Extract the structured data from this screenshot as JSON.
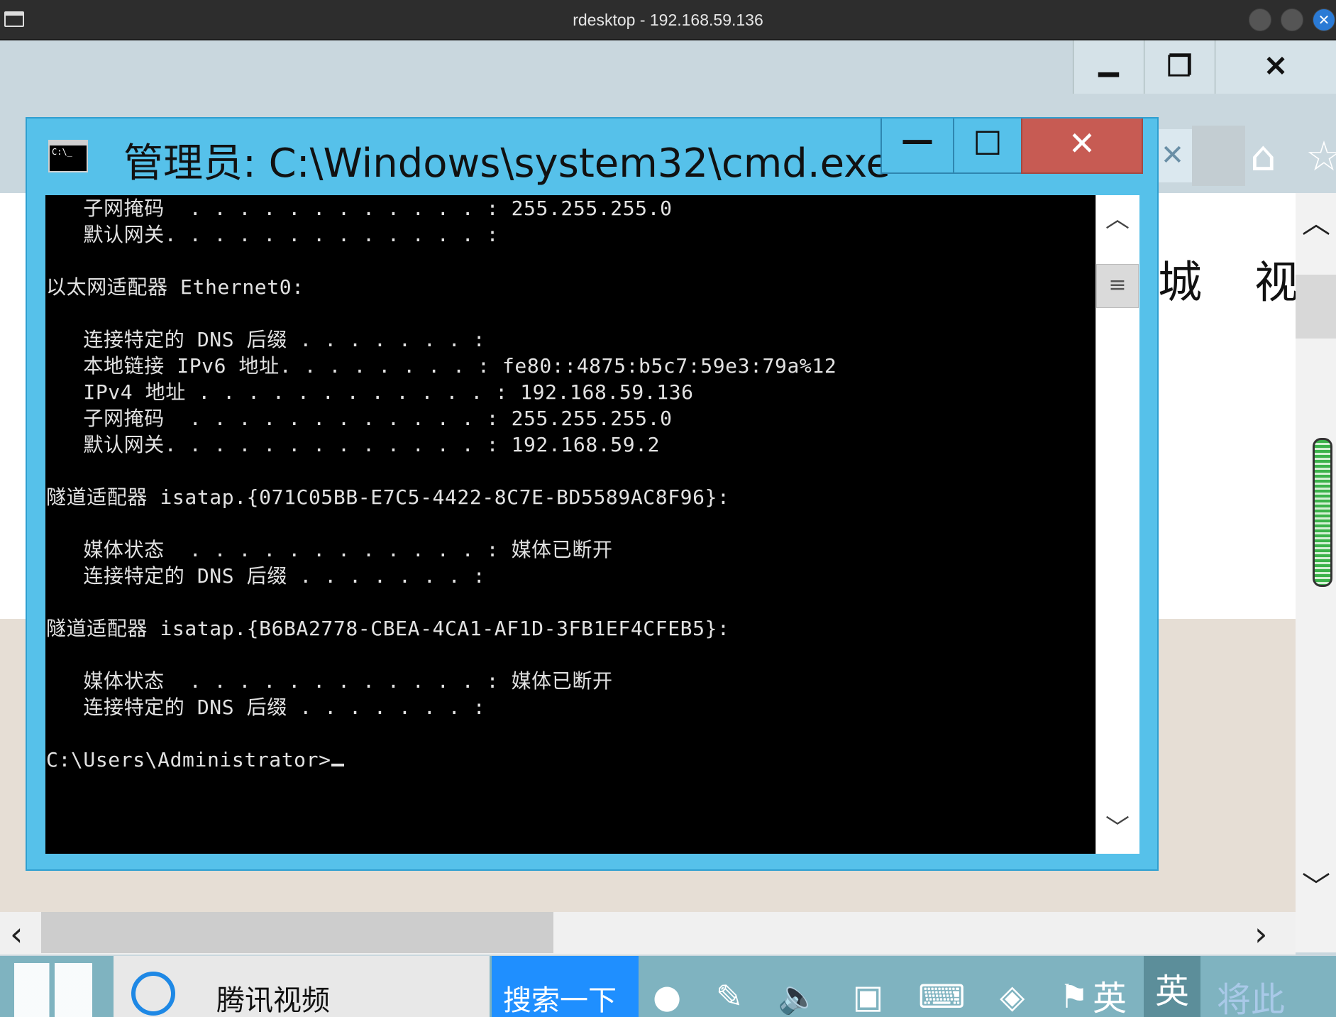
{
  "host": {
    "title": "rdesktop - 192.168.59.136",
    "close_glyph": "✕"
  },
  "background_browser": {
    "minimize_glyph": "▁",
    "restore_glyph": "❐",
    "close_glyph": "✕",
    "tab_close_glyph": "✕",
    "home_glyph": "⌂",
    "favorites_glyph": "☆",
    "char_1": "城",
    "char_2": "视",
    "scroll_up": "︿",
    "scroll_down": "﹀",
    "scroll_left": "‹",
    "scroll_right": "›"
  },
  "taskbar": {
    "ie_label": "腾讯视频",
    "search_label": "搜索一下",
    "lang_1": "英",
    "lang_2": "英",
    "faded_text": "将此"
  },
  "cmd": {
    "title": "管理员: C:\\Windows\\system32\\cmd.exe",
    "icon_text": "C:\\_",
    "minimize_glyph": "—",
    "maximize_glyph": "☐",
    "close_glyph": "✕",
    "scroll_up_glyph": "︿",
    "scroll_thumb_glyph": "≡",
    "scroll_down_glyph": "﹀",
    "lines": [
      "   子网掩码  . . . . . . . . . . . . : 255.255.255.0",
      "   默认网关. . . . . . . . . . . . . :",
      "",
      "以太网适配器 Ethernet0:",
      "",
      "   连接特定的 DNS 后缀 . . . . . . . :",
      "   本地链接 IPv6 地址. . . . . . . . : fe80::4875:b5c7:59e3:79a%12",
      "   IPv4 地址 . . . . . . . . . . . . : 192.168.59.136",
      "   子网掩码  . . . . . . . . . . . . : 255.255.255.0",
      "   默认网关. . . . . . . . . . . . . : 192.168.59.2",
      "",
      "隧道适配器 isatap.{071C05BB-E7C5-4422-8C7E-BD5589AC8F96}:",
      "",
      "   媒体状态  . . . . . . . . . . . . : 媒体已断开",
      "   连接特定的 DNS 后缀 . . . . . . . :",
      "",
      "隧道适配器 isatap.{B6BA2778-CBEA-4CA1-AF1D-3FB1EF4CFEB5}:",
      "",
      "   媒体状态  . . . . . . . . . . . . : 媒体已断开",
      "   连接特定的 DNS 后缀 . . . . . . . :",
      "",
      "C:\\Users\\Administrator>"
    ]
  }
}
